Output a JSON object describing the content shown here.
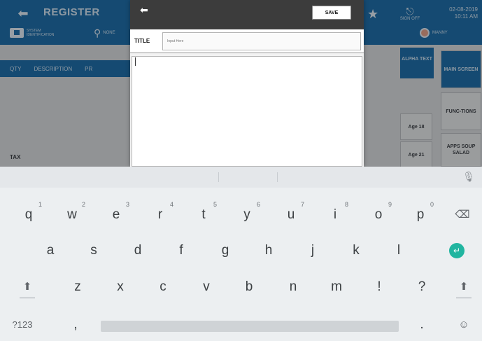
{
  "app": {
    "title": "REGISTER",
    "system_id_label": "SYSTEM IDENTIFICATION",
    "search_label": "NONE",
    "sign_off_label": "SIGN OFF",
    "date": "02-08-2019",
    "time": "10:11 AM",
    "user": "MANNY",
    "table_headers": [
      "QTY",
      "DESCRIPTION",
      "PR"
    ],
    "tax_label": "TAX",
    "alpha_text_label": "ALPHA TEXT",
    "age_buttons": [
      "Age 18",
      "Age 21"
    ],
    "side_buttons": [
      "MAIN SCREEN",
      "FUNC-TIONS",
      "APPS SOUP SALAD"
    ]
  },
  "dialog": {
    "save_label": "SAVE",
    "title_label": "TITLE",
    "title_placeholder": "Input Here",
    "text_value": ""
  },
  "keyboard": {
    "row1": [
      {
        "key": "q",
        "hint": "1"
      },
      {
        "key": "w",
        "hint": "2"
      },
      {
        "key": "e",
        "hint": "3"
      },
      {
        "key": "r",
        "hint": "4"
      },
      {
        "key": "t",
        "hint": "5"
      },
      {
        "key": "y",
        "hint": "6"
      },
      {
        "key": "u",
        "hint": "7"
      },
      {
        "key": "i",
        "hint": "8"
      },
      {
        "key": "o",
        "hint": "9"
      },
      {
        "key": "p",
        "hint": "0"
      }
    ],
    "row2": [
      "a",
      "s",
      "d",
      "f",
      "g",
      "h",
      "j",
      "k",
      "l"
    ],
    "row3": [
      "z",
      "x",
      "c",
      "v",
      "b",
      "n",
      "m",
      "!",
      "?"
    ],
    "symbols_label": "?123",
    "comma": ",",
    "period": ".",
    "enter_glyph": "↵",
    "backspace_glyph": "⌫",
    "shift_glyph": "⬆",
    "emoji_glyph": "☺",
    "mic_glyph": "🎙"
  }
}
